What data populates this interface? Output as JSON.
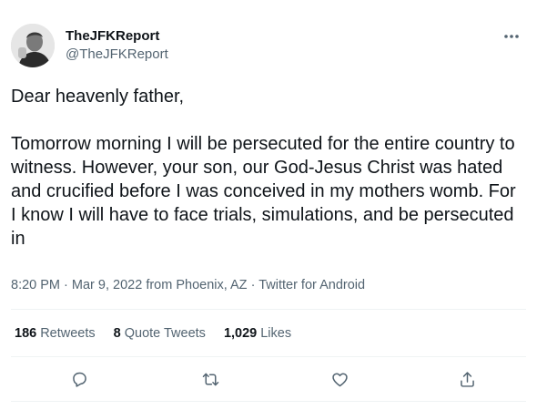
{
  "user": {
    "display_name": "TheJFKReport",
    "handle": "@TheJFKReport"
  },
  "tweet": {
    "text": "Dear heavenly father,\n\nTomorrow morning I will be persecuted for the entire country to witness. However, your son, our God-Jesus Christ was hated and crucified before I was conceived in my mothers womb. For I know I will have to face trials, simulations, and be persecuted in",
    "time": "8:20 PM",
    "separator": "·",
    "date": "Mar 9, 2022",
    "location": "from Phoenix, AZ",
    "source": "Twitter for Android"
  },
  "stats": {
    "retweets_count": "186",
    "retweets_label": "Retweets",
    "quotes_count": "8",
    "quotes_label": "Quote Tweets",
    "likes_count": "1,029",
    "likes_label": "Likes"
  },
  "icons": {
    "more": "more-icon",
    "reply": "reply-icon",
    "retweet": "retweet-icon",
    "like": "heart-icon",
    "share": "share-icon"
  },
  "colors": {
    "text": "#0f1419",
    "secondary": "#536471",
    "divider": "#eff3f4"
  }
}
